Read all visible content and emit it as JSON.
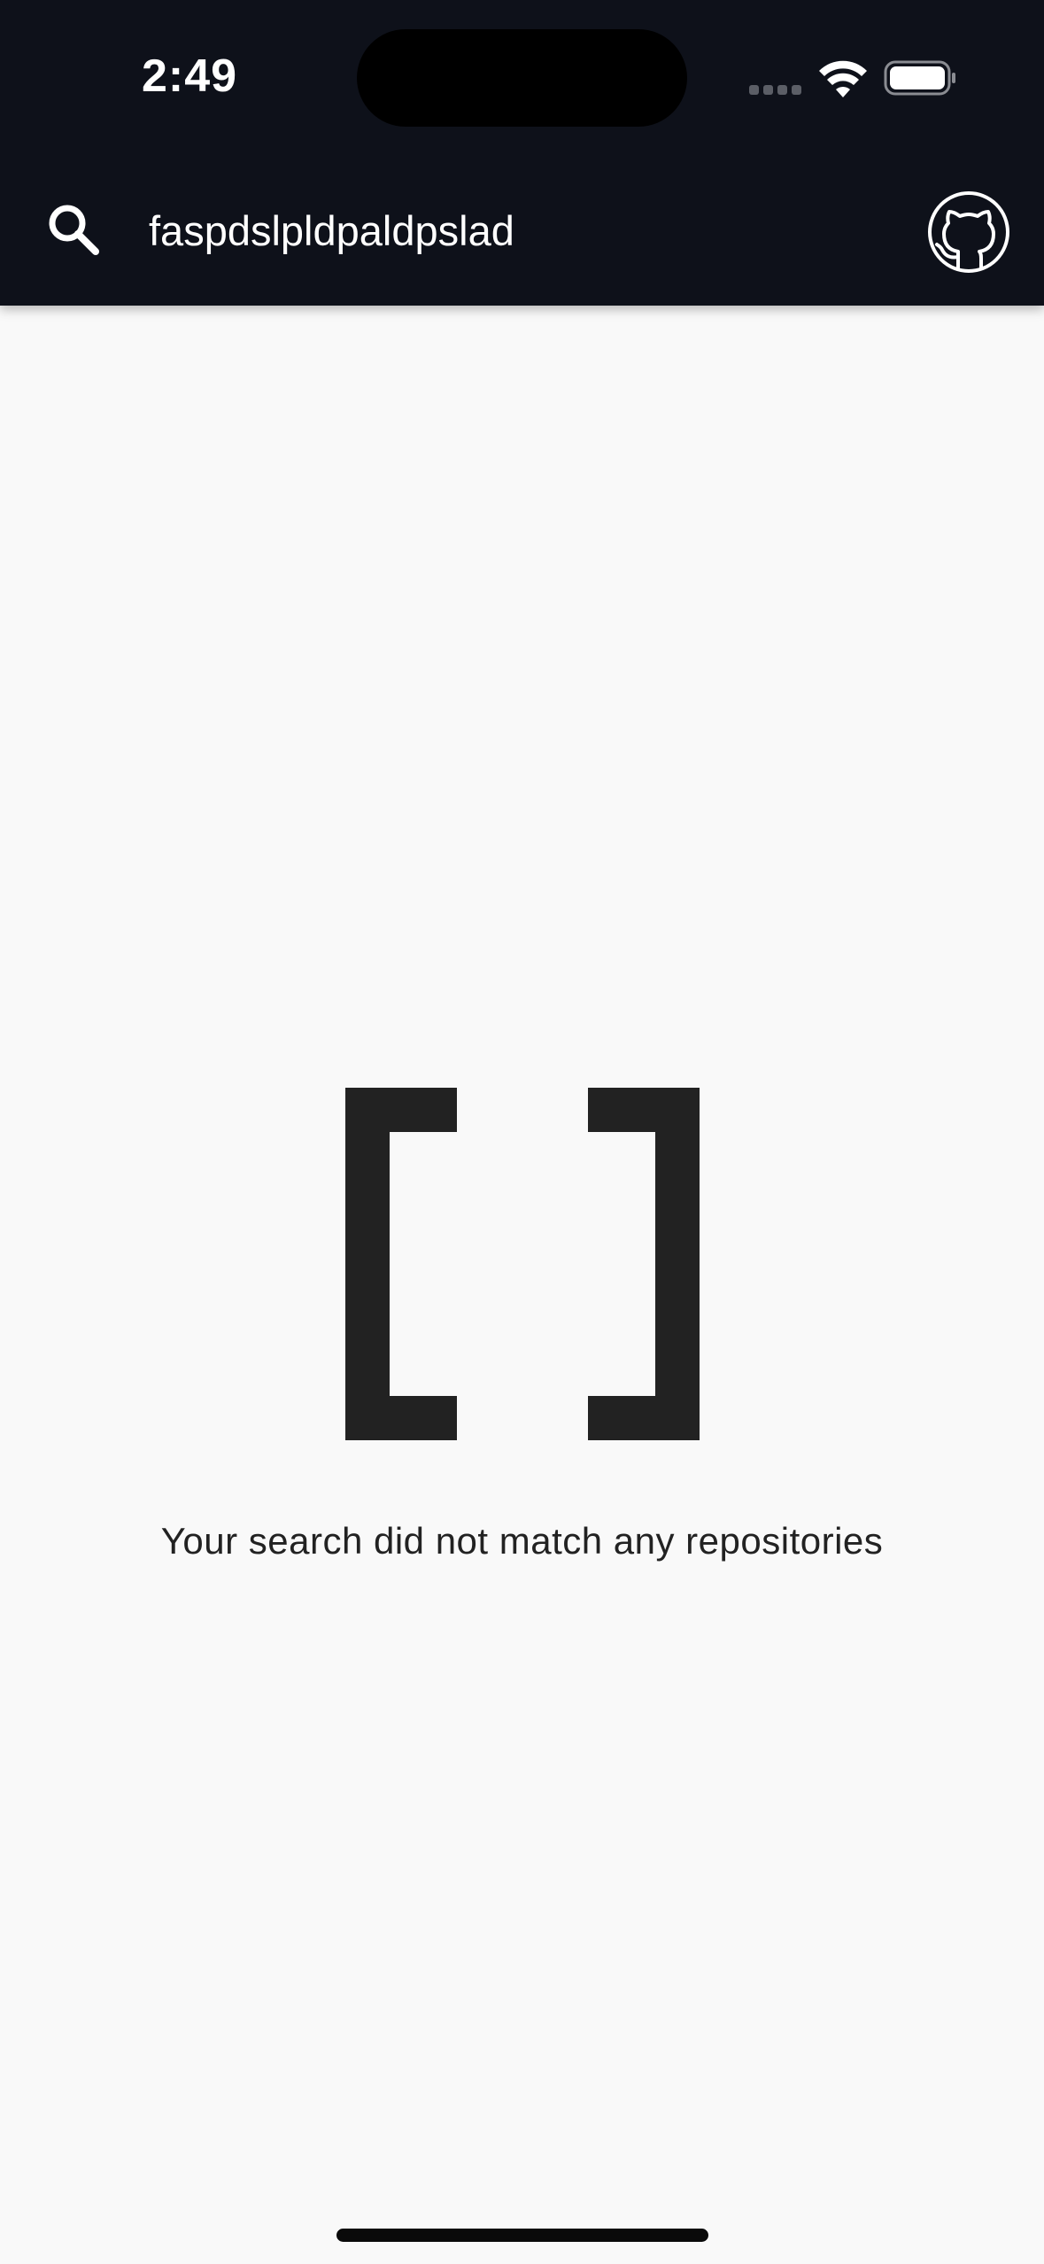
{
  "status_bar": {
    "time": "2:49"
  },
  "app_bar": {
    "search_query": "faspdslpldpaldpslad",
    "search_icon": "search-icon",
    "github_icon": "github-icon"
  },
  "empty_state": {
    "graphic": "empty-brackets",
    "message": "Your search did not match any repositories"
  },
  "colors": {
    "app_bar_bg": "#0e111a",
    "page_bg": "#f9f9f9",
    "text_dark": "#222222",
    "text_light": "#ffffff"
  }
}
